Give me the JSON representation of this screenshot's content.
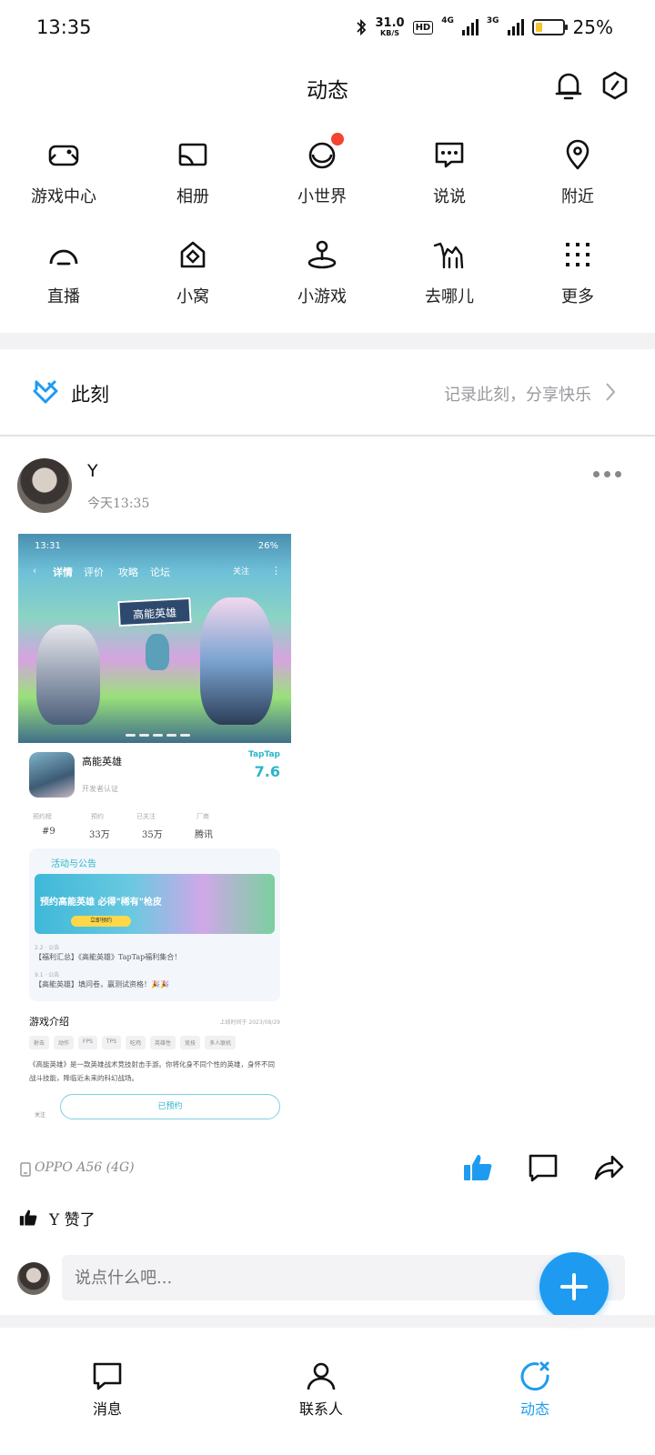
{
  "status_bar": {
    "time": "13:35",
    "speed": "31.0",
    "speed_unit": "KB/S",
    "hd": "HD",
    "net1": "4G",
    "net2": "3G",
    "battery_percent": "25%",
    "battery_level": 0.25
  },
  "header": {
    "title": "动态"
  },
  "grid": [
    {
      "label": "游戏中心",
      "icon": "gamepad-icon"
    },
    {
      "label": "相册",
      "icon": "photo-album-icon"
    },
    {
      "label": "小世界",
      "icon": "small-world-icon",
      "badge": true
    },
    {
      "label": "说说",
      "icon": "chat-bubble-icon"
    },
    {
      "label": "附近",
      "icon": "location-pin-icon"
    },
    {
      "label": "直播",
      "icon": "live-icon"
    },
    {
      "label": "小窝",
      "icon": "home-icon"
    },
    {
      "label": "小游戏",
      "icon": "joystick-icon"
    },
    {
      "label": "去哪儿",
      "icon": "camel-icon"
    },
    {
      "label": "更多",
      "icon": "grid-dots-icon"
    }
  ],
  "moment": {
    "title": "此刻",
    "hint": "记录此刻，分享快乐"
  },
  "post": {
    "author": "Y",
    "time": "今天13:35",
    "device": "OPPO A56 (4G)",
    "liked_by": "Y 赞了",
    "comment_placeholder": "说点什么吧..."
  },
  "embedded": {
    "status_time": "13:31",
    "battery": "26%",
    "tabs": [
      "详情",
      "评价",
      "攻略",
      "论坛"
    ],
    "follow": "关注",
    "banner_logo": "高能英雄",
    "game_name": "高能英雄",
    "game_sub": "开发者认证",
    "taptap": "TapTap",
    "score": "7.6",
    "stats": [
      {
        "label": "预约榜",
        "value": "#9"
      },
      {
        "label": "预约",
        "value": "33万"
      },
      {
        "label": "已关注",
        "value": "35万"
      },
      {
        "label": "厂商",
        "value": "腾讯"
      }
    ],
    "activity_title": "活动与公告",
    "activity_banner": "预约高能英雄 必得\"稀有\"枪皮",
    "activity_button": "立即预约",
    "activity_items": [
      {
        "date": "2.2 · 公告",
        "text": "【福利汇总】《高能英雄》TapTap福利集合！"
      },
      {
        "date": "9.1 · 公告",
        "text": "【高能英雄】填问卷，赢测试资格！🎉🎉"
      }
    ],
    "intro_title": "游戏介绍",
    "intro_date": "上线时间于 2023/08/29",
    "tags": [
      "射击",
      "动作",
      "FPS",
      "TPS",
      "吃鸡",
      "英雄性",
      "竞技",
      "多人联机"
    ],
    "intro_text": "《高能英雄》是一款英雄战术竞技射击手游。你将化身不同个性的英雄，身怀不同战斗技能，降临近未来的科幻战场。",
    "booked_button": "已预约",
    "side_label": "关注"
  },
  "bottom_nav": [
    {
      "label": "消息",
      "icon": "message-icon",
      "active": false
    },
    {
      "label": "联系人",
      "icon": "contacts-icon",
      "active": false
    },
    {
      "label": "动态",
      "icon": "feed-icon",
      "active": true
    }
  ],
  "colors": {
    "accent": "#1e9bf0",
    "badge": "#f2442e",
    "taptap": "#2bb6c9"
  }
}
